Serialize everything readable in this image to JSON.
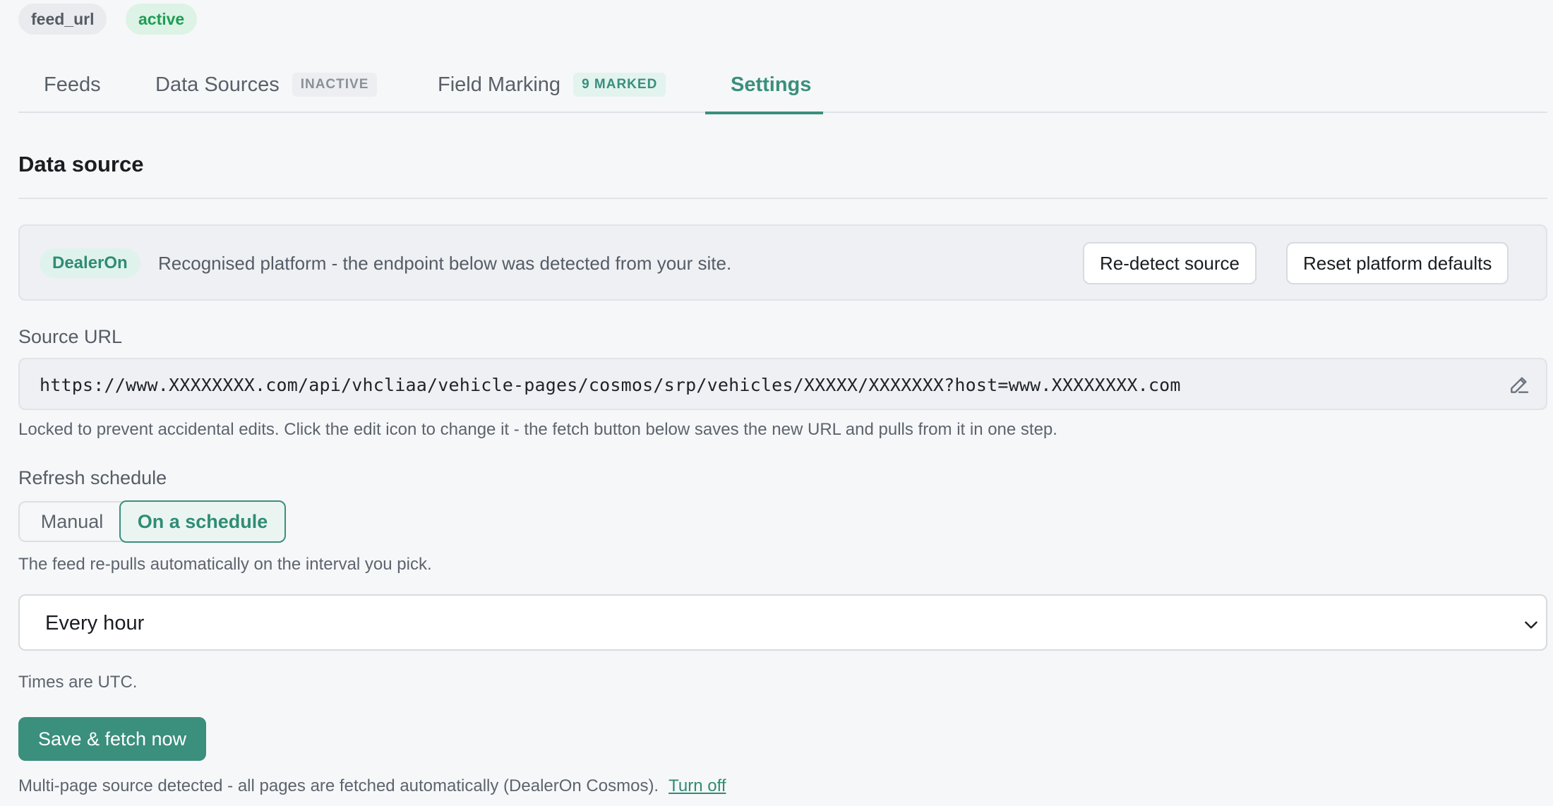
{
  "header": {
    "tags": [
      {
        "label": "feed_url"
      },
      {
        "label": "active"
      }
    ]
  },
  "tabs": [
    {
      "label": "Feeds",
      "badge": ""
    },
    {
      "label": "Data Sources",
      "badge": "INACTIVE"
    },
    {
      "label": "Field Marking",
      "badge": "9 MARKED"
    },
    {
      "label": "Settings",
      "badge": "",
      "active": true
    }
  ],
  "section": {
    "title": "Data source"
  },
  "platform": {
    "badge": "DealerOn",
    "message": "Recognised platform - the endpoint below was detected from your site.",
    "redetect_label": "Re-detect source",
    "reset_label": "Reset platform defaults"
  },
  "source_url": {
    "label": "Source URL",
    "value": "https://www.XXXXXXXX.com/api/vhcliaa/vehicle-pages/cosmos/srp/vehicles/XXXXX/XXXXXXX?host=www.XXXXXXXX.com",
    "edit_icon": "pencil-icon",
    "help": "Locked to prevent accidental edits. Click the edit icon to change it - the fetch button below saves the new URL and pulls from it in one step."
  },
  "schedule": {
    "label": "Refresh schedule",
    "options": [
      "Manual",
      "On a schedule"
    ],
    "selected": "On a schedule",
    "help": "The feed re-pulls automatically on the interval you pick.",
    "interval": "Every hour",
    "timezone_note": "Times are UTC."
  },
  "actions": {
    "save_fetch_label": "Save & fetch now"
  },
  "footer": {
    "multipage_text": "Multi-page source detected - all pages are fetched automatically (DealerOn Cosmos).",
    "turn_off_label": "Turn off"
  },
  "colors": {
    "accent": "#3a8f7d",
    "active_green": "#1f9d55",
    "background": "#f6f7f8"
  }
}
